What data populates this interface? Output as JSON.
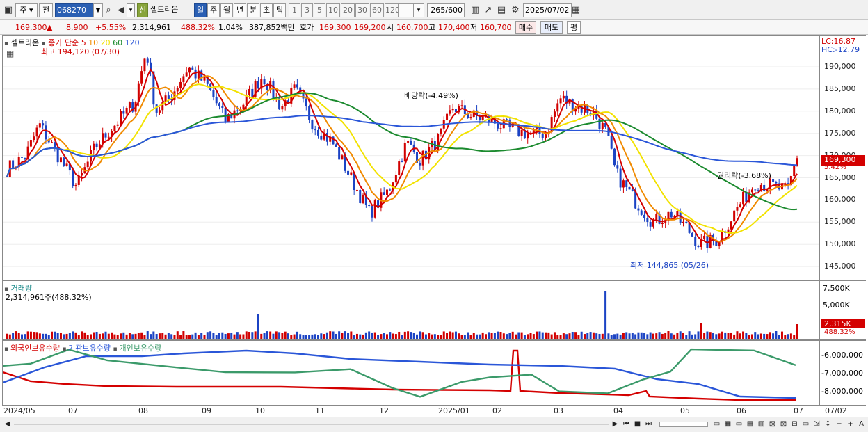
{
  "toolbar": {
    "type_select": "주",
    "prev_label": "전",
    "code": "068270",
    "new_badge": "신",
    "name": "셀트리온",
    "periods": [
      "일",
      "주",
      "월",
      "년",
      "분",
      "초",
      "틱"
    ],
    "active_period": "일",
    "intervals": [
      "1",
      "3",
      "5",
      "10",
      "20",
      "30",
      "60",
      "120"
    ],
    "count": "265",
    "count_total": "/600",
    "date": "2025/07/02"
  },
  "quote": {
    "price": "169,300",
    "change_arrow": "▲",
    "change": "8,900",
    "change_pct": "+5.55%",
    "volume": "2,314,961",
    "volume_ratio": "488.32%",
    "turnover": "1.04%",
    "amount": "387,852백만",
    "ask_label": "호가",
    "ask": "169,300",
    "bid": "169,200",
    "open_label": "시",
    "open": "160,700",
    "high_label": "고",
    "high": "170,400",
    "low_label": "저",
    "low": "160,700",
    "buy_button": "매수",
    "sell_button": "매도",
    "eval_button": "평"
  },
  "price_pane": {
    "legend_name": "셀트리온",
    "legend_ma_label": "종가 단순",
    "ma_periods": [
      "5",
      "10",
      "20",
      "60",
      "120"
    ],
    "ma_colors": [
      "#d40000",
      "#f08a00",
      "#f2e200",
      "#1b8a2e",
      "#2a56d8"
    ],
    "lc": "LC:16.87",
    "hc": "HC:-12.79",
    "yticks": [
      "190,000",
      "185,000",
      "180,000",
      "175,000",
      "170,000",
      "165,000",
      "160,000",
      "155,000",
      "150,000",
      "145,000"
    ],
    "current_price_tag": "169,300",
    "current_pct_tag": "5.42%",
    "annotations": {
      "high": "최고 194,120 (07/30)",
      "low": "최저 144,865 (05/26)",
      "dividend": "배당락(-4.49%)",
      "rights": "권리락(-3.68%)"
    }
  },
  "volume_pane": {
    "title": "거래량",
    "value": "2,314,961주(488.32%)",
    "yticks": [
      "7,500K",
      "5,000K"
    ],
    "current_tag": "2,315K",
    "current_pct": "488.32%"
  },
  "holdings_pane": {
    "series": [
      "외국인보유수량",
      "기관보유수량",
      "개인보유수량"
    ],
    "series_colors": [
      "#d40000",
      "#2a56d8",
      "#3b9a6a"
    ],
    "yticks": [
      "-6,000,000",
      "-7,000,000",
      "-8,000,000"
    ]
  },
  "xaxis": {
    "labels": [
      "2024/05",
      "07",
      "08",
      "09",
      "10",
      "11",
      "12",
      "2025/01",
      "02",
      "03",
      "04",
      "05",
      "06",
      "07"
    ],
    "right_label": "07/02"
  },
  "colors": {
    "up": "#d10000",
    "down": "#1b43c4",
    "accent": "#2a5fb3"
  }
}
